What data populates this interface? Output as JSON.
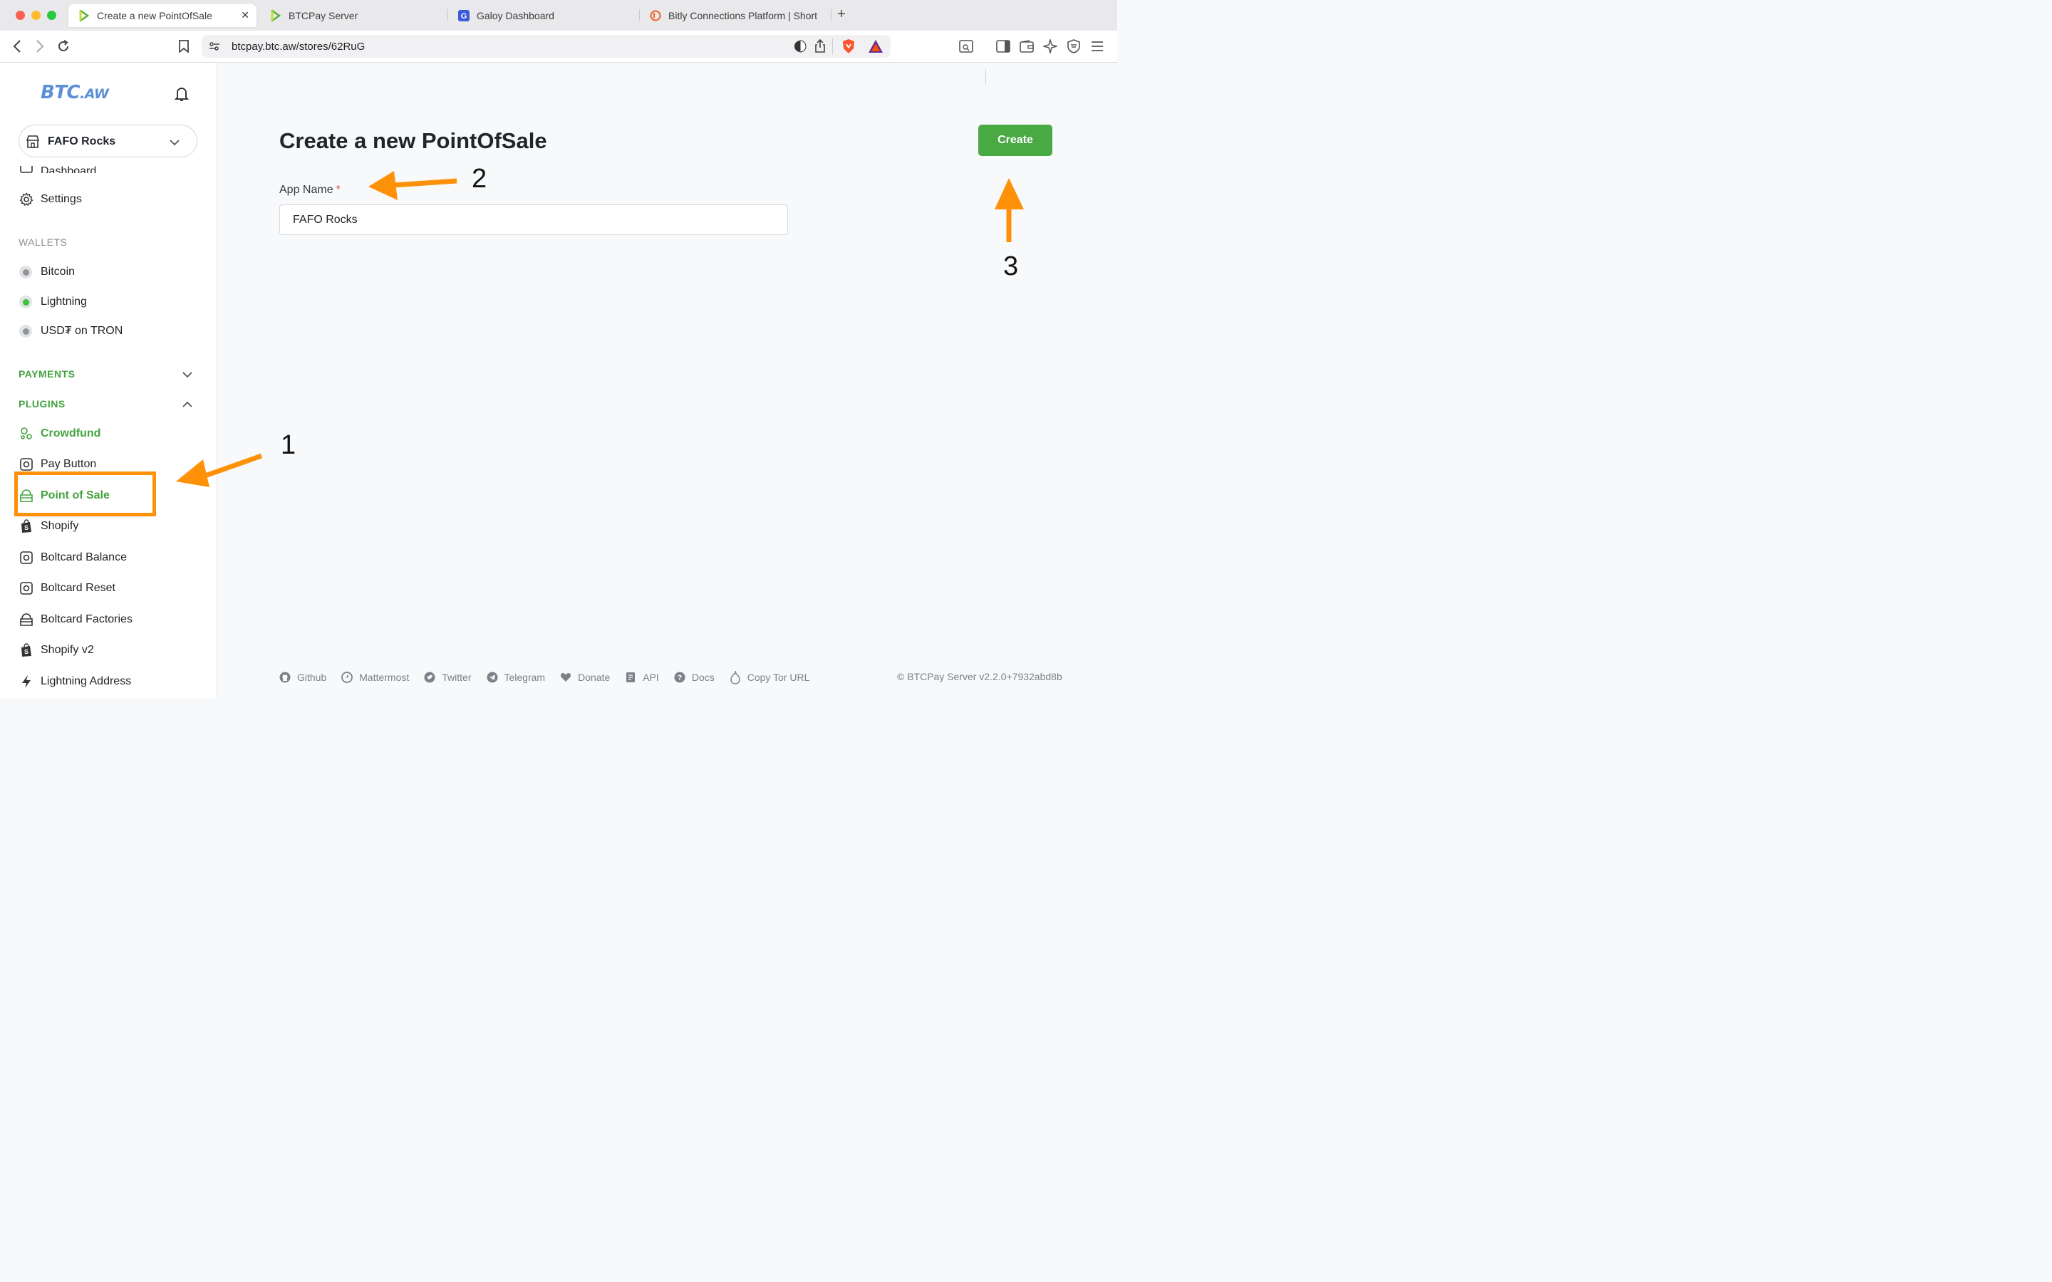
{
  "browser": {
    "tabs": [
      {
        "title": "Create a new PointOfSale",
        "active": true,
        "icon": "btcpay-logo-icon"
      },
      {
        "title": "BTCPay Server",
        "active": false,
        "icon": "btcpay-logo-icon"
      },
      {
        "title": "Galoy Dashboard",
        "active": false,
        "icon": "galoy-g-icon"
      },
      {
        "title": "Bitly Connections Platform | Short l",
        "active": false,
        "icon": "bitly-icon"
      }
    ],
    "url": "btcpay.btc.aw/stores/62RuG"
  },
  "sidebar": {
    "logo_main": "BTC",
    "logo_suffix": ".AW",
    "store_name": "FAFO Rocks",
    "partial_item": "Dashboard",
    "settings": "Settings",
    "wallets_heading": "WALLETS",
    "wallets": [
      {
        "label": "Bitcoin",
        "status_color": "#8f959b"
      },
      {
        "label": "Lightning",
        "status_color": "#3cc23c"
      },
      {
        "label": "USD₮ on TRON",
        "status_color": "#8f959b"
      }
    ],
    "payments_heading": "PAYMENTS",
    "plugins_heading": "PLUGINS",
    "plugins": [
      {
        "label": "Crowdfund",
        "icon": "crowdfund-icon",
        "active": false,
        "green": true
      },
      {
        "label": "Pay Button",
        "icon": "pay-button-icon",
        "active": false
      },
      {
        "label": "Point of Sale",
        "icon": "point-of-sale-icon",
        "active": true
      },
      {
        "label": "Shopify",
        "icon": "shopify-icon",
        "active": false
      },
      {
        "label": "Boltcard Balance",
        "icon": "boltcard-icon",
        "active": false
      },
      {
        "label": "Boltcard Reset",
        "icon": "boltcard-icon",
        "active": false
      },
      {
        "label": "Boltcard Factories",
        "icon": "factory-icon",
        "active": false
      },
      {
        "label": "Shopify v2",
        "icon": "shopify-icon",
        "active": false
      },
      {
        "label": "Lightning Address",
        "icon": "lightning-bolt-icon",
        "active": false
      }
    ]
  },
  "main": {
    "title": "Create a new PointOfSale",
    "create_button": "Create",
    "app_name_label": "App Name",
    "required_mark": "*",
    "app_name_value": "FAFO Rocks"
  },
  "annotations": {
    "step1": "1",
    "step2": "2",
    "step3": "3",
    "color": "#ff9108"
  },
  "footer": {
    "links": [
      "Github",
      "Mattermost",
      "Twitter",
      "Telegram",
      "Donate",
      "API",
      "Docs",
      "Copy Tor URL"
    ],
    "copyright": "© BTCPay Server v2.2.0+7932abd8b"
  },
  "colors": {
    "accent_green": "#49a942",
    "nav_green": "#44a340",
    "annotation_orange": "#ff9108"
  }
}
